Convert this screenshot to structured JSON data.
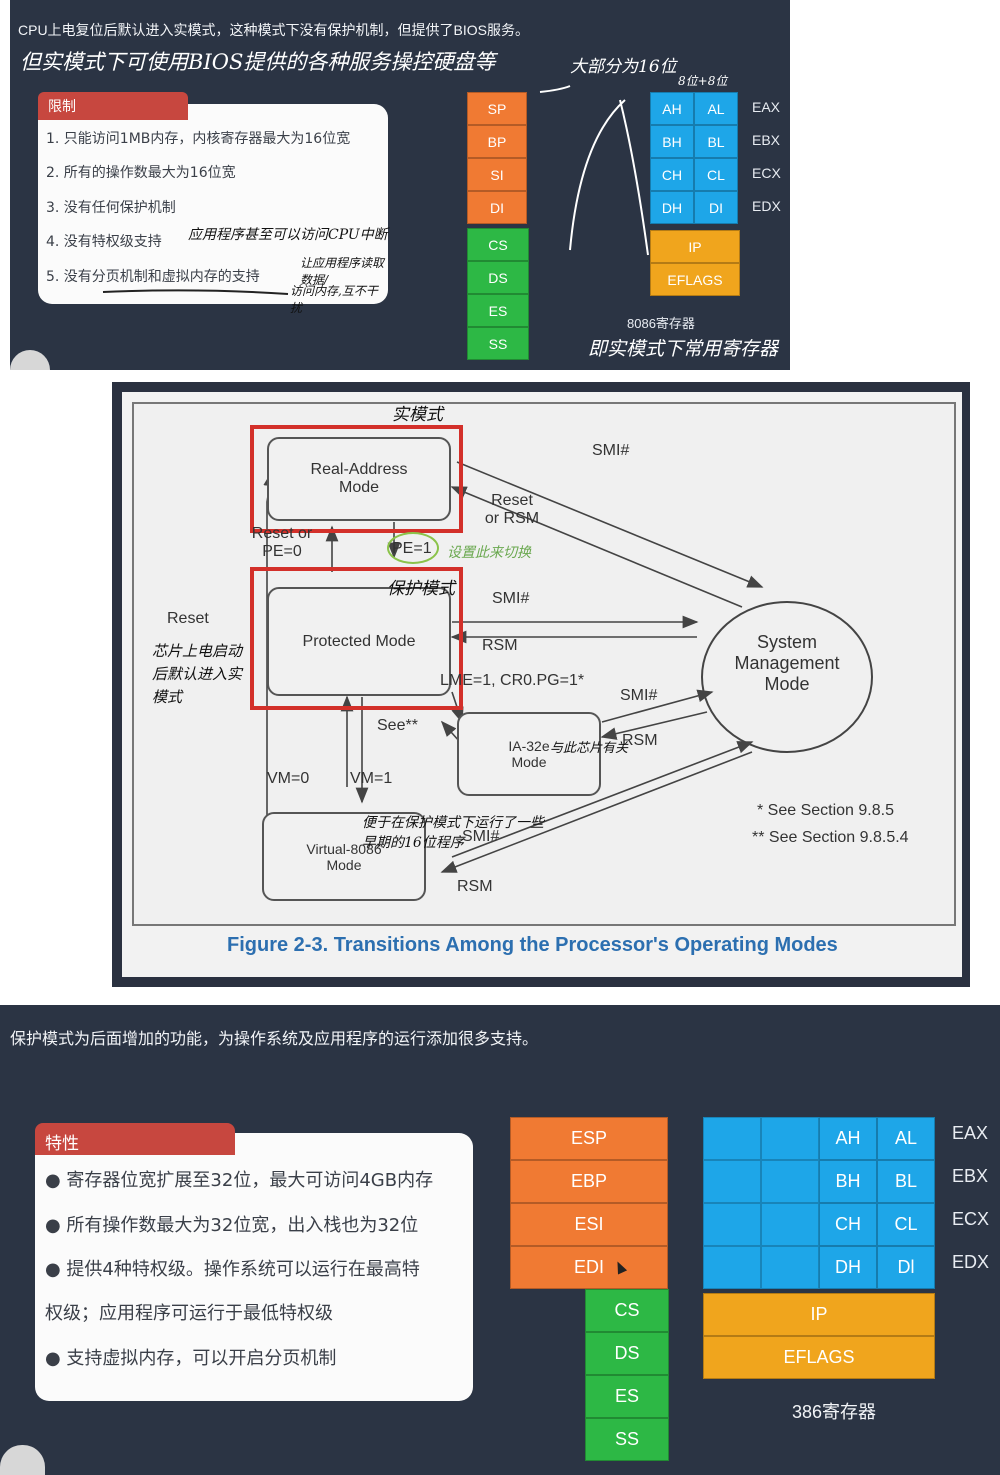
{
  "top": {
    "header": "CPU上电复位后默认进入实模式，这种模式下没有保护机制，但提供了BIOS服务。",
    "handwritten_note1": "但实模式下可使用BIOS提供的各种服务操控硬盘等",
    "card_title": "限制",
    "items": [
      "1. 只能访问1MB内存，内核寄存器最大为16位宽",
      "2. 所有的操作数最大为16位宽",
      "3. 没有任何保护机制",
      "4. 没有特权级支持",
      "5. 没有分页机制和虚拟内存的支持"
    ],
    "note_privilege": "应用程序甚至可以访问CPU中断",
    "note_paging": "让应用程序读取数据/",
    "note_paging2": "访问内存,互不干扰",
    "note_mostly": "大部分为16位",
    "note_8bit": "8位+8位",
    "regs_orange": [
      "SP",
      "BP",
      "SI",
      "DI"
    ],
    "regs_green": [
      "CS",
      "DS",
      "ES",
      "SS"
    ],
    "regs_blue": [
      [
        "AH",
        "AL"
      ],
      [
        "BH",
        "BL"
      ],
      [
        "CH",
        "CL"
      ],
      [
        "DH",
        "DI"
      ]
    ],
    "regs_blue_names": [
      "EAX",
      "EBX",
      "ECX",
      "EDX"
    ],
    "regs_gold": [
      "IP",
      "EFLAGS"
    ],
    "caption": "8086寄存器",
    "caption_note": "即实模式下常用寄存器"
  },
  "diagram": {
    "real_mode": "Real-Address Mode",
    "protected_mode": "Protected Mode",
    "ia32e": "IA-32e Mode",
    "v86": "Virtual-8086 Mode",
    "smm": "System Management Mode",
    "labels": {
      "smi1": "SMI#",
      "reset_or_rsm": "Reset or RSM",
      "reset_or_pe0": "Reset or PE=0",
      "pe1": "PE=1",
      "smi2": "SMI#",
      "rsm1": "RSM",
      "lme": "LME=1, CR0.PG=1*",
      "see": "See**",
      "smi3": "SMI#",
      "rsm2": "RSM",
      "reset": "Reset",
      "vm0": "VM=0",
      "vm1": "VM=1",
      "smi4": "SMI#",
      "rsm3": "RSM"
    },
    "footnote1": "* See Section 9.8.5",
    "footnote2": "** See Section 9.8.5.4",
    "caption": "Figure 2-3.  Transitions Among the Processor's Operating Modes",
    "hand_real": "实模式",
    "hand_pe1": "设置此来切换",
    "hand_protected": "保护模式",
    "hand_reset": "芯片上电启动后默认进入实模式",
    "hand_ia32e": "与此芯片有关",
    "hand_v86": "便于在保护模式下运行了一些早期的16位程序"
  },
  "bottom": {
    "header": "保护模式为后面增加的功能，为操作系统及应用程序的运行添加很多支持。",
    "card_title": "特性",
    "items": [
      "● 寄存器位宽扩展至32位，最大可访问4GB内存",
      "● 所有操作数最大为32位宽，出入栈也为32位",
      "● 提供4种特权级。操作系统可以运行在最高特",
      "权级；应用程序可运行于最低特权级",
      "● 支持虚拟内存，可以开启分页机制"
    ],
    "regs_orange": [
      "ESP",
      "EBP",
      "ESI",
      "EDI"
    ],
    "regs_green": [
      "CS",
      "DS",
      "ES",
      "SS"
    ],
    "regs_blue": [
      [
        "AH",
        "AL"
      ],
      [
        "BH",
        "BL"
      ],
      [
        "CH",
        "CL"
      ],
      [
        "DH",
        "Dl"
      ]
    ],
    "regs_blue_names": [
      "EAX",
      "EBX",
      "ECX",
      "EDX"
    ],
    "regs_gold": [
      "IP",
      "EFLAGS"
    ],
    "caption": "386寄存器"
  }
}
